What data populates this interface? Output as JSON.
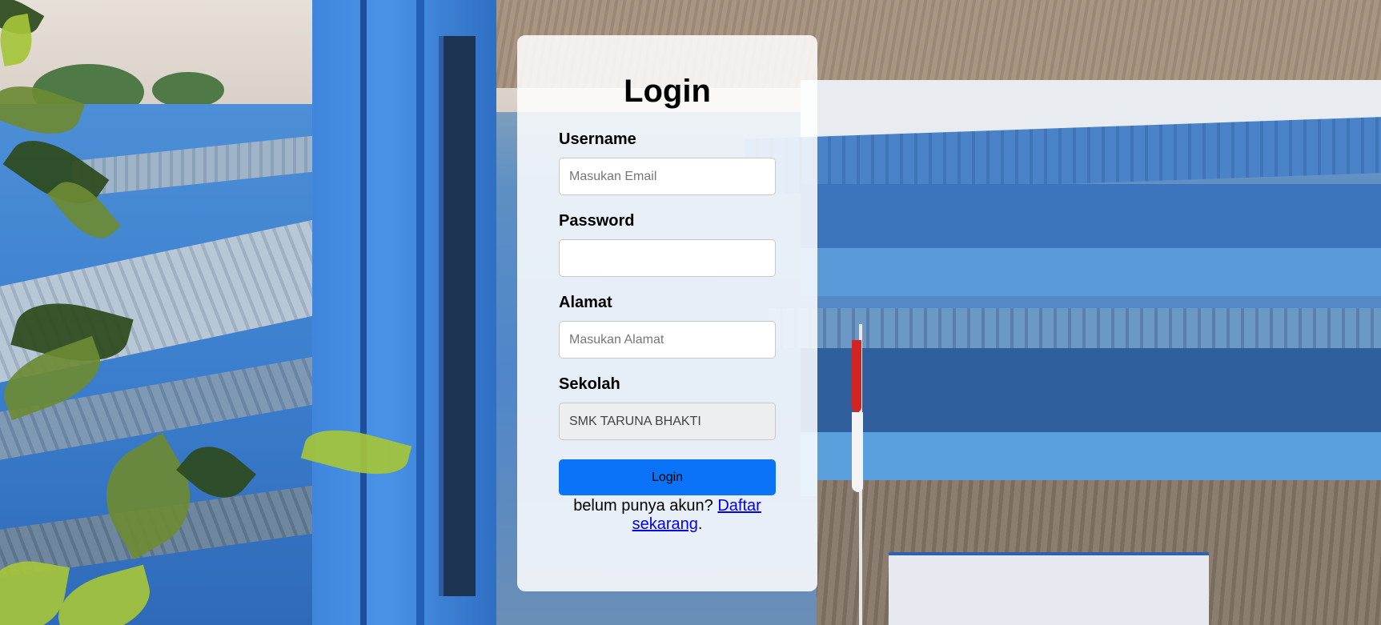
{
  "login_form": {
    "title": "Login",
    "username": {
      "label": "Username",
      "placeholder": "Masukan Email",
      "value": ""
    },
    "password": {
      "label": "Password",
      "placeholder": "",
      "value": ""
    },
    "alamat": {
      "label": "Alamat",
      "placeholder": "Masukan Alamat",
      "value": ""
    },
    "sekolah": {
      "label": "Sekolah",
      "value": "SMK TARUNA BHAKTI"
    },
    "submit_label": "Login",
    "register_prompt": "belum punya akun?",
    "register_link": "Daftar sekarang",
    "register_suffix": "."
  },
  "colors": {
    "button": "#0a73f7",
    "link": "#0000ee",
    "card": "rgba(255,255,255,0.86)"
  },
  "background": {
    "scene": "school building photo"
  }
}
